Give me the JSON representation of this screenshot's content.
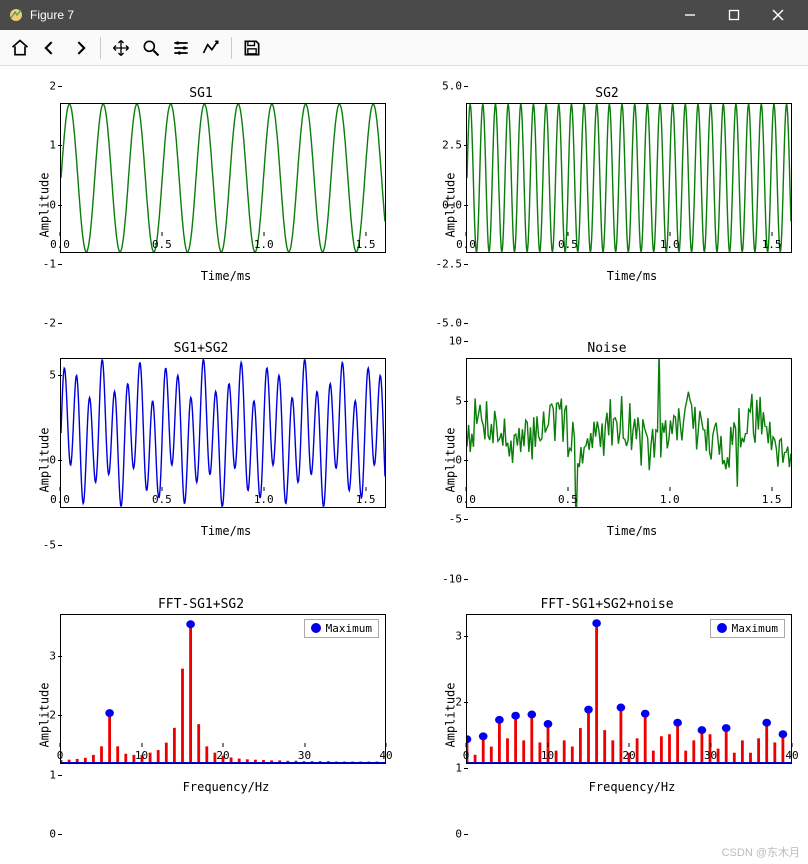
{
  "window": {
    "title": "Figure 7"
  },
  "toolbar": {
    "home": "home-icon",
    "back": "back-icon",
    "forward": "forward-icon",
    "pan": "pan-icon",
    "zoom": "zoom-icon",
    "config": "config-icon",
    "edit": "edit-icon",
    "save": "save-icon"
  },
  "watermark": "CSDN @东木月",
  "legend_label": "Maximum",
  "chart_data": [
    {
      "id": "sg1",
      "type": "line",
      "title": "SG1",
      "xlabel": "Time/ms",
      "ylabel": "Amplitude",
      "xlim": [
        0,
        1.6
      ],
      "ylim": [
        -2,
        2
      ],
      "xticks": [
        0.0,
        0.5,
        1.0,
        1.5
      ],
      "yticks": [
        -2,
        -1,
        0,
        1,
        2
      ],
      "color": "#0a7d0a",
      "series": {
        "kind": "sine",
        "amp": 2,
        "freq_hz": 6,
        "phase": 0,
        "n": 400,
        "xmax": 1.6
      }
    },
    {
      "id": "sg2",
      "type": "line",
      "title": "SG2",
      "xlabel": "Time/ms",
      "ylabel": "Amplitude",
      "xlim": [
        0,
        1.6
      ],
      "ylim": [
        -5,
        5
      ],
      "xticks": [
        0.0,
        0.5,
        1.0,
        1.5
      ],
      "yticks": [
        -5.0,
        -2.5,
        0.0,
        2.5,
        5.0
      ],
      "color": "#0a7d0a",
      "series": {
        "kind": "sine",
        "amp": 5,
        "freq_hz": 16,
        "phase": 0,
        "n": 600,
        "xmax": 1.6
      }
    },
    {
      "id": "sum",
      "type": "line",
      "title": "SG1+SG2",
      "xlabel": "Time/ms",
      "ylabel": "Amplitude",
      "xlim": [
        0,
        1.6
      ],
      "ylim": [
        -7,
        7
      ],
      "xticks": [
        0.0,
        0.5,
        1.0,
        1.5
      ],
      "yticks": [
        -5,
        0,
        5
      ],
      "color": "#0000dd",
      "series": {
        "kind": "sum2sine",
        "a1": 2,
        "f1": 6,
        "a2": 5,
        "f2": 16,
        "n": 600,
        "xmax": 1.6
      }
    },
    {
      "id": "noise",
      "type": "line",
      "title": "Noise",
      "xlabel": "Time/ms",
      "ylabel": "Amplitude",
      "xlim": [
        0,
        1.6
      ],
      "ylim": [
        -10,
        10
      ],
      "xticks": [
        0.0,
        0.5,
        1.0,
        1.5
      ],
      "yticks": [
        -10,
        -5,
        0,
        5,
        10
      ],
      "color": "#0a7d0a",
      "series": {
        "kind": "noise",
        "base_amp": 3.5,
        "spike_amp": 10,
        "n": 200,
        "xmax": 1.6,
        "seed": 7
      }
    },
    {
      "id": "fft1",
      "type": "bar",
      "title": "FFT-SG1+SG2",
      "xlabel": "Frequency/Hz",
      "ylabel": "Amplitude",
      "xlim": [
        0,
        40
      ],
      "ylim": [
        0,
        4
      ],
      "xticks": [
        0,
        10,
        20,
        30,
        40
      ],
      "yticks": [
        0,
        1,
        2,
        3
      ],
      "bar_color": "#ee0000",
      "marker_color": "#0000ee",
      "legend": "Maximum",
      "x": [
        0,
        1,
        2,
        3,
        4,
        5,
        6,
        7,
        8,
        9,
        10,
        11,
        12,
        13,
        14,
        15,
        16,
        17,
        18,
        19,
        20,
        21,
        22,
        23,
        24,
        25,
        26,
        27,
        28,
        29,
        30,
        31,
        32,
        33,
        34,
        35,
        36,
        37,
        38,
        39
      ],
      "values": [
        0.08,
        0.09,
        0.11,
        0.14,
        0.22,
        0.45,
        1.35,
        0.45,
        0.25,
        0.22,
        0.22,
        0.28,
        0.35,
        0.55,
        0.95,
        2.55,
        3.75,
        1.05,
        0.45,
        0.28,
        0.2,
        0.15,
        0.12,
        0.1,
        0.09,
        0.08,
        0.07,
        0.07,
        0.06,
        0.06,
        0.05,
        0.05,
        0.05,
        0.05,
        0.04,
        0.04,
        0.04,
        0.04,
        0.04,
        0.04
      ],
      "markers_x": [
        6,
        16
      ],
      "markers_y": [
        1.35,
        3.75
      ]
    },
    {
      "id": "fft2",
      "type": "bar",
      "title": "FFT-SG1+SG2+noise",
      "xlabel": "Frequency/Hz",
      "ylabel": "Amplitude",
      "xlim": [
        0,
        40
      ],
      "ylim": [
        0,
        3.6
      ],
      "xticks": [
        0,
        10,
        20,
        30,
        40
      ],
      "yticks": [
        0,
        1,
        2,
        3
      ],
      "bar_color": "#ee0000",
      "marker_color": "#0000ee",
      "legend": "Maximum",
      "x": [
        0,
        1,
        2,
        3,
        4,
        5,
        6,
        7,
        8,
        9,
        10,
        11,
        12,
        13,
        14,
        15,
        16,
        17,
        18,
        19,
        20,
        21,
        22,
        23,
        24,
        25,
        26,
        27,
        28,
        29,
        30,
        31,
        32,
        33,
        34,
        35,
        36,
        37,
        38,
        39
      ],
      "values": [
        0.58,
        0.2,
        0.65,
        0.4,
        1.05,
        0.6,
        1.15,
        0.55,
        1.18,
        0.5,
        0.95,
        0.3,
        0.55,
        0.4,
        0.85,
        1.3,
        3.4,
        0.8,
        0.55,
        1.35,
        0.25,
        0.6,
        1.2,
        0.3,
        0.65,
        0.7,
        0.98,
        0.3,
        0.55,
        0.8,
        0.7,
        0.35,
        0.85,
        0.25,
        0.55,
        0.25,
        0.6,
        0.98,
        0.5,
        0.7
      ],
      "markers_x": [
        0,
        2,
        4,
        6,
        8,
        10,
        15,
        16,
        19,
        22,
        26,
        29,
        32,
        37,
        39
      ],
      "markers_y": [
        0.58,
        0.65,
        1.05,
        1.15,
        1.18,
        0.95,
        1.3,
        3.4,
        1.35,
        1.2,
        0.98,
        0.8,
        0.85,
        0.98,
        0.7
      ]
    }
  ]
}
